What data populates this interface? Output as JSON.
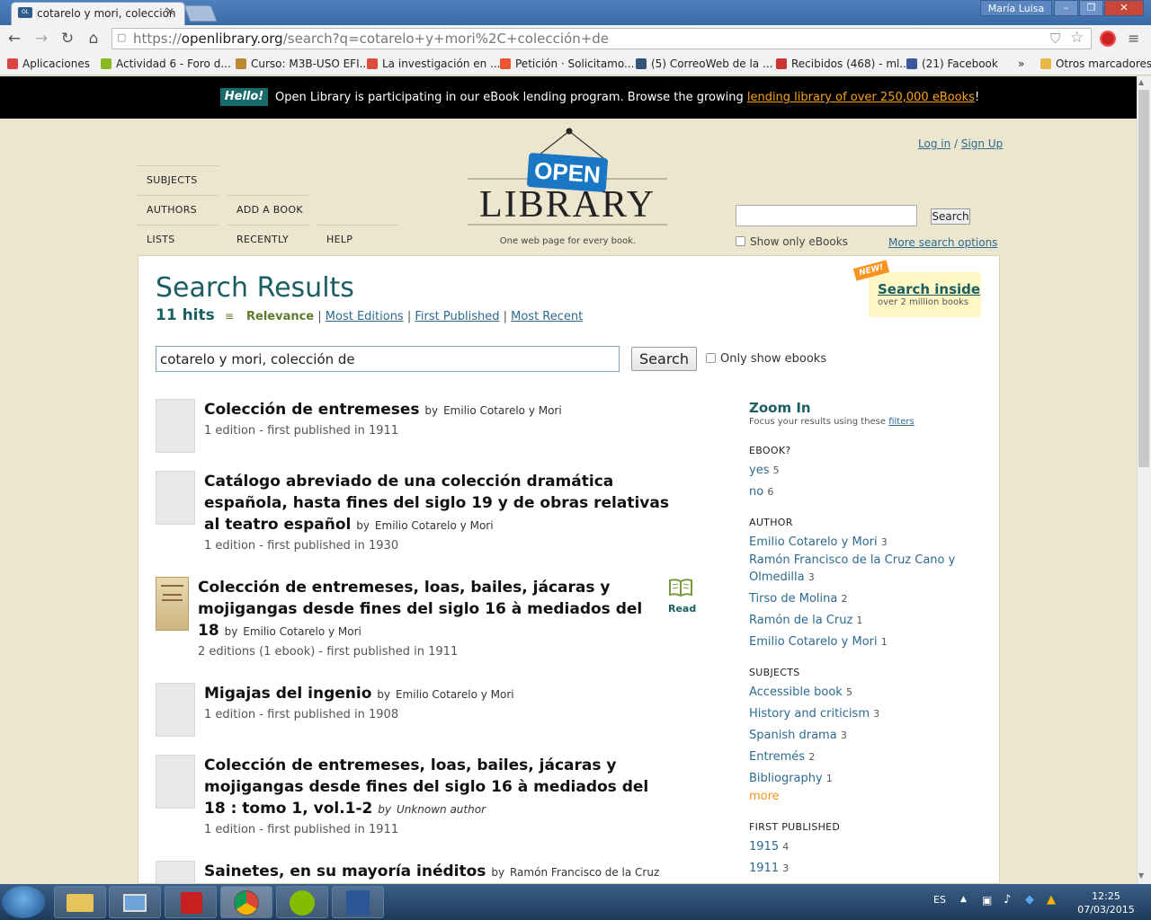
{
  "browser": {
    "tab_title": "cotarelo y mori, colección",
    "favicon_text": "OL",
    "user_name": "María Luisa",
    "url_prefix": "https://",
    "url_host": "openlibrary.org",
    "url_path": "/search?q=cotarelo+y+mori%2C+colección+de",
    "bookmarks": [
      {
        "label": "Aplicaciones",
        "color": "#d44"
      },
      {
        "label": "Actividad 6 - Foro d...",
        "color": "#8b2"
      },
      {
        "label": "Curso: M3B-USO EFI...",
        "color": "#b83"
      },
      {
        "label": "La investigación en ...",
        "color": "#dd4b39"
      },
      {
        "label": "Petición · Solicitamo...",
        "color": "#e53"
      },
      {
        "label": "(5) CorreoWeb de la ...",
        "color": "#357"
      },
      {
        "label": "Recibidos (468) - ml...",
        "color": "#c33"
      },
      {
        "label": "(21) Facebook",
        "color": "#3b5998"
      },
      {
        "label": "»",
        "color": ""
      },
      {
        "label": "Otros marcadores",
        "color": "#e8b84a"
      }
    ]
  },
  "banner": {
    "hello": "Hello!",
    "text": "Open Library is participating in our eBook lending program. Browse the growing ",
    "link": "lending library of over 250,000 eBooks",
    "end": "!"
  },
  "header": {
    "login": "Log in",
    "sep": " / ",
    "signup": "Sign Up",
    "nav": {
      "subjects": "SUBJECTS",
      "authors": "AUTHORS",
      "add_book": "ADD A BOOK",
      "lists": "LISTS",
      "recently": "RECENTLY",
      "help": "HELP"
    },
    "logo_top": "OPEN",
    "logo_bottom": "LIBRARY",
    "tagline": "One web page for every book.",
    "search_btn": "Search",
    "only_ebooks": "Show only eBooks",
    "more_options": "More search options"
  },
  "results": {
    "title": "Search Results",
    "hits": "11 hits",
    "sort_current": "Relevance",
    "sort_links": [
      "Most Editions",
      "First Published",
      "Most Recent"
    ],
    "query": "cotarelo y mori, colección de",
    "search_btn": "Search",
    "only_show": "Only show ebooks",
    "new_badge": "NEW!",
    "search_inside": "Search inside",
    "search_inside_sub": "over 2 million books",
    "read_label": "Read",
    "items": [
      {
        "title": "Colección de entremeses",
        "by": "by",
        "author": "Emilio Cotarelo y Mori",
        "meta": "1 edition - first published in 1911"
      },
      {
        "title": "Catálogo abreviado de una colección dramática española, hasta fines del siglo 19 y de obras relativas al teatro español",
        "by": "by",
        "author": "Emilio Cotarelo y Mori",
        "meta": "1 edition - first published in 1930"
      },
      {
        "title": "Colección de entremeses, loas, bailes, jácaras y mojigangas desde fines del siglo 16 à mediados del 18",
        "by": "by",
        "author": "Emilio Cotarelo y Mori",
        "meta": "2 editions (1 ebook) - first published in 1911"
      },
      {
        "title": "Migajas del ingenio",
        "by": "by",
        "author": "Emilio Cotarelo y Mori",
        "meta": "1 edition - first published in 1908"
      },
      {
        "title": "Colección de entremeses, loas, bailes, jácaras y mojigangas desde fines del siglo 16 à mediados del 18 : tomo 1, vol.1-2",
        "by": "by",
        "author": "Unknown author",
        "meta": "1 edition - first published in 1911"
      },
      {
        "title": "Sainetes, en su mayoría inéditos",
        "by": "by",
        "author": "Ramón Francisco de la Cruz",
        "meta": ""
      }
    ]
  },
  "sidebar": {
    "zoom": "Zoom In",
    "zoom_sub": "Focus your results using these ",
    "zoom_link": "filters",
    "ebook_h": "EBOOK?",
    "ebook": [
      {
        "label": "yes",
        "n": "5"
      },
      {
        "label": "no",
        "n": "6"
      }
    ],
    "author_h": "AUTHOR",
    "authors": [
      {
        "label": "Emilio Cotarelo y Mori",
        "n": "3"
      },
      {
        "label": "Ramón Francisco de la Cruz Cano y Olmedilla",
        "n": "3"
      },
      {
        "label": "Tirso de Molina",
        "n": "2"
      },
      {
        "label": "Ramón de la Cruz",
        "n": "1"
      },
      {
        "label": "Emilio Cotarelo y Mori",
        "n": "1"
      }
    ],
    "subjects_h": "SUBJECTS",
    "subjects": [
      {
        "label": "Accessible book",
        "n": "5"
      },
      {
        "label": "History and criticism",
        "n": "3"
      },
      {
        "label": "Spanish drama",
        "n": "3"
      },
      {
        "label": "Entremés",
        "n": "2"
      },
      {
        "label": "Bibliography",
        "n": "1"
      }
    ],
    "more": "more",
    "first_pub_h": "FIRST PUBLISHED",
    "first_pub": [
      {
        "label": "1915",
        "n": "4"
      },
      {
        "label": "1911",
        "n": "3"
      }
    ]
  },
  "taskbar": {
    "lang": "ES",
    "time": "12:25",
    "date": "07/03/2015"
  }
}
